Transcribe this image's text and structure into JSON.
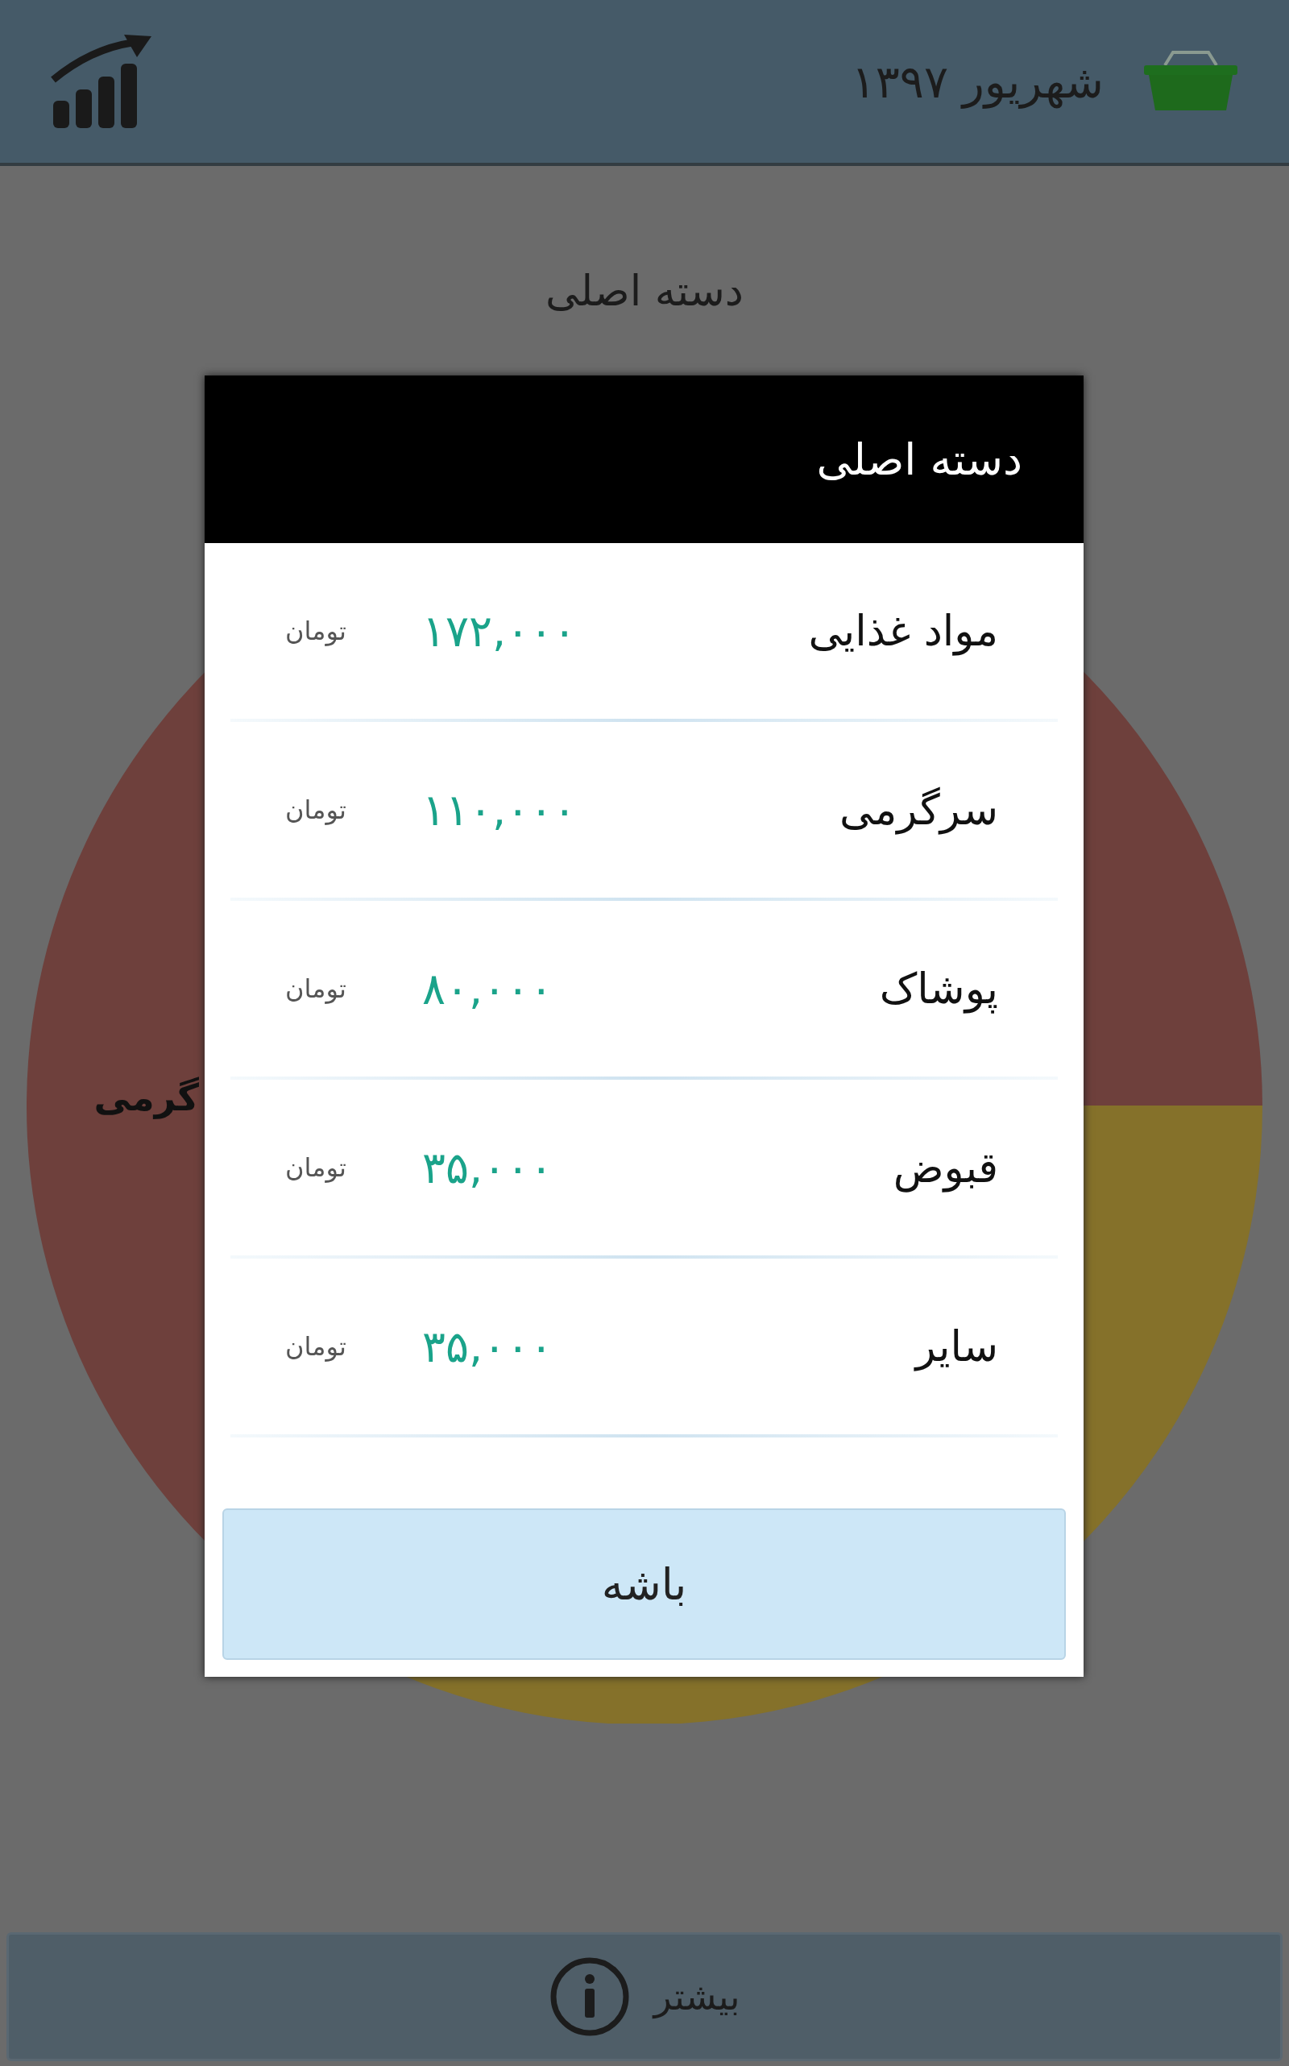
{
  "header": {
    "title": "شهریور ۱۳۹۷"
  },
  "page_title": "دسته اصلی",
  "pie_label": "گرمی",
  "dialog": {
    "title": "دسته اصلی",
    "rows": [
      {
        "name": "مواد غذایی",
        "amount": "۱۷۲,۰۰۰",
        "unit": "تومان"
      },
      {
        "name": "سرگرمی",
        "amount": "۱۱۰,۰۰۰",
        "unit": "تومان"
      },
      {
        "name": "پوشاک",
        "amount": "۸۰,۰۰۰",
        "unit": "تومان"
      },
      {
        "name": "قبوض",
        "amount": "۳۵,۰۰۰",
        "unit": "تومان"
      },
      {
        "name": "سایر",
        "amount": "۳۵,۰۰۰",
        "unit": "تومان"
      }
    ],
    "button": "باشه"
  },
  "footer": {
    "label": "بیشتر"
  }
}
